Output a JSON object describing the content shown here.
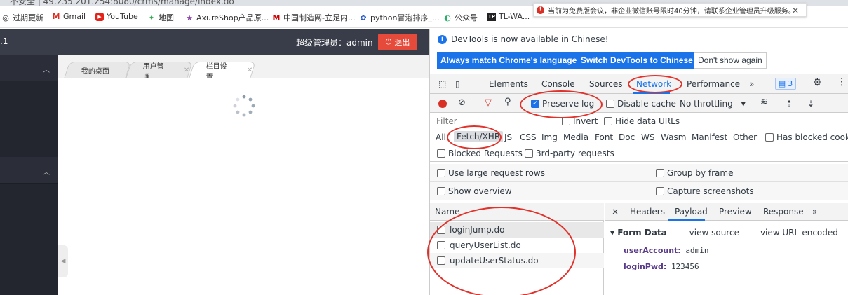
{
  "browser": {
    "url": "不安全 | 49.235.201.254:8080/crms/manage/index.do",
    "bookmarks": [
      {
        "icon": "apps-icon",
        "label": "过期更新"
      },
      {
        "icon": "gmail-icon",
        "label": "Gmail"
      },
      {
        "icon": "youtube-icon",
        "label": "YouTube"
      },
      {
        "icon": "maps-icon",
        "label": "地图"
      },
      {
        "icon": "star-icon",
        "label": "AxureShop产品原..."
      },
      {
        "icon": "made-in-china-icon",
        "label": "中国制造网-立足内..."
      },
      {
        "icon": "paw-icon",
        "label": "python冒泡排序_..."
      },
      {
        "icon": "wechat-icon",
        "label": "公众号"
      },
      {
        "icon": "tplink-icon",
        "label": "TL-WA..."
      }
    ],
    "notification": "当前为免费版会议，非企业微信账号限时40分钟，请联系企业管理员升级服务。"
  },
  "app": {
    "brand_fragment": ".1",
    "admin_text": "超级管理员：admin",
    "logout_label": "退出",
    "tabs": [
      {
        "label": "我的桌面",
        "closable": false
      },
      {
        "label": "用户管理",
        "closable": true
      },
      {
        "label": "栏目设置",
        "closable": true
      }
    ]
  },
  "devtools": {
    "info_message": "DevTools is now available in Chinese!",
    "btn_match": "Always match Chrome's language",
    "btn_switch": "Switch DevTools to Chinese",
    "btn_dont_show": "Don't show again",
    "tabs": [
      "Elements",
      "Console",
      "Sources",
      "Network",
      "Performance",
      "»"
    ],
    "active_tab": "Network",
    "issues_count": "3",
    "toolbar": {
      "preserve_log": "Preserve log",
      "disable_cache": "Disable cache",
      "throttling": "No throttling"
    },
    "filter_placeholder": "Filter",
    "invert": "Invert",
    "hide_data_urls": "Hide data URLs",
    "types": [
      "All",
      "Fetch/XHR",
      "JS",
      "CSS",
      "Img",
      "Media",
      "Font",
      "Doc",
      "WS",
      "Wasm",
      "Manifest",
      "Other"
    ],
    "has_blocked": "Has blocked cooki",
    "blocked_requests": "Blocked Requests",
    "third_party": "3rd-party requests",
    "large_rows": "Use large request rows",
    "group_by_frame": "Group by frame",
    "show_overview": "Show overview",
    "capture_screenshots": "Capture screenshots",
    "name_header": "Name",
    "requests": [
      "loginJump.do",
      "queryUserList.do",
      "updateUserStatus.do"
    ],
    "detail_tabs": [
      "×",
      "Headers",
      "Payload",
      "Preview",
      "Response",
      "»"
    ],
    "form_data": {
      "title": "▾ Form Data",
      "view_source": "view source",
      "view_url_encoded": "view URL-encoded",
      "fields": [
        {
          "key": "userAccount:",
          "value": "admin"
        },
        {
          "key": "loginPwd:",
          "value": "123456"
        }
      ]
    }
  },
  "colors": {
    "annotation": "#e0322b",
    "accent": "#1a73e8",
    "header_bg": "#393d49",
    "logout": "#e64a3b"
  }
}
